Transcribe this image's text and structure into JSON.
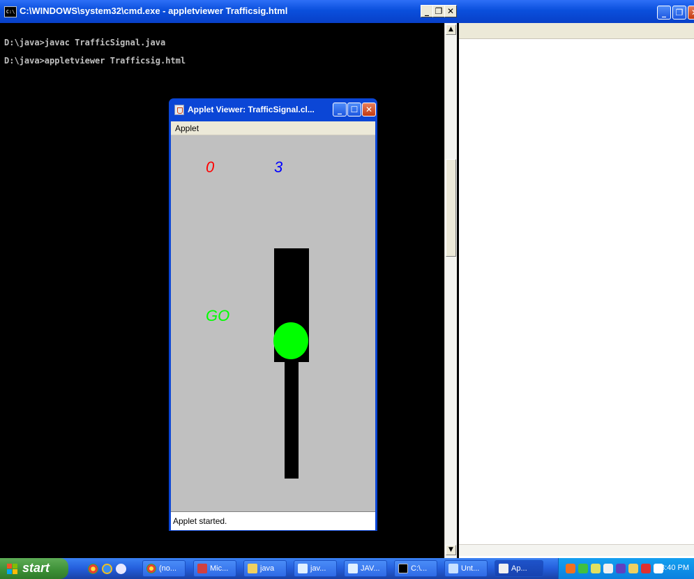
{
  "cmd_window": {
    "title": "C:\\WINDOWS\\system32\\cmd.exe - appletviewer Trafficsig.html",
    "icon_text": "C:\\",
    "lines": [
      "D:\\java>javac TrafficSignal.java",
      "D:\\java>appletviewer Trafficsig.html"
    ],
    "buttons": {
      "minimize": "_",
      "restore": "❐",
      "close": "✕"
    }
  },
  "applet_viewer": {
    "title": "Applet Viewer: TrafficSignal.cl...",
    "menu": "Applet",
    "status": "Applet started.",
    "canvas": {
      "counter_left": "0",
      "counter_right": "3",
      "signal_text": "GO",
      "colors": {
        "counter_left": "#ff0000",
        "counter_right": "#0000ff",
        "signal_text": "#00ff00",
        "light": "#00ff00",
        "background": "#c0c0c0"
      }
    }
  },
  "taskbar": {
    "start_label": "start",
    "items": [
      {
        "label": "(no...",
        "icon": "chrome-icon"
      },
      {
        "label": "Mic...",
        "icon": "word-icon"
      },
      {
        "label": "java",
        "icon": "folder-icon"
      },
      {
        "label": "jav...",
        "icon": "notepad-icon"
      },
      {
        "label": "JAV...",
        "icon": "notepad-icon"
      },
      {
        "label": "C:\\...",
        "icon": "cmd-icon"
      },
      {
        "label": "Unt...",
        "icon": "document-icon"
      },
      {
        "label": "Ap...",
        "icon": "java-icon"
      }
    ],
    "clock": "3:40 PM"
  }
}
